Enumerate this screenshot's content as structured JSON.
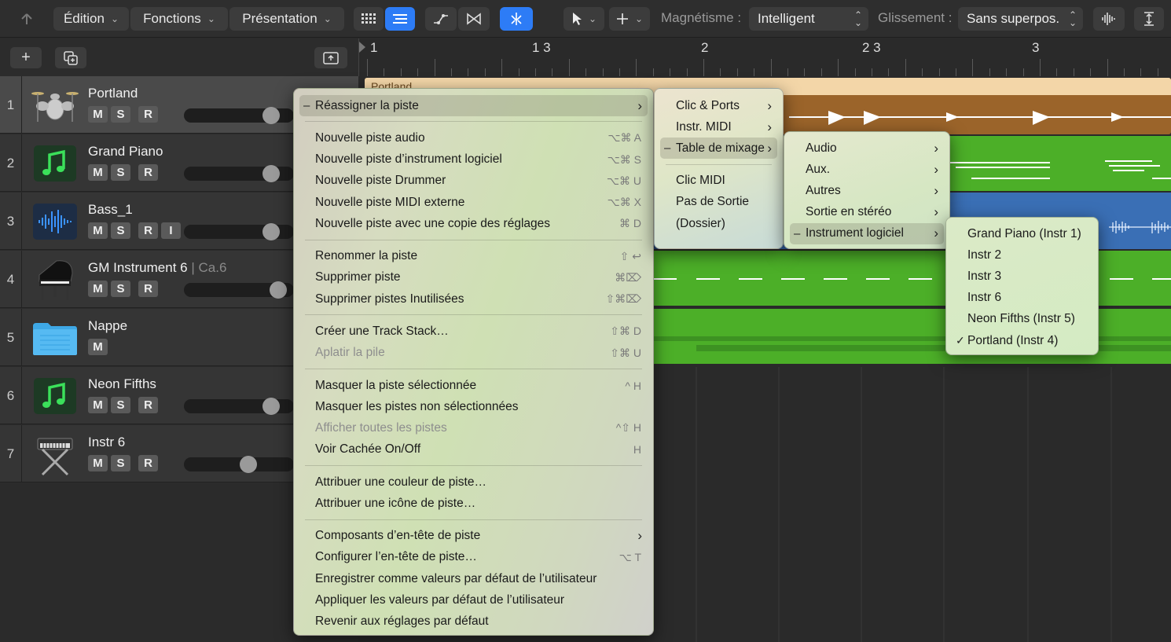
{
  "toolbar": {
    "menus": [
      "Édition",
      "Fonctions",
      "Présentation"
    ],
    "snap_label": "Magnétisme :",
    "snap_value": "Intelligent",
    "drag_label": "Glissement :",
    "drag_value": "Sans superpos."
  },
  "ruler": {
    "labels": [
      "1",
      "1 3",
      "2",
      "2 3",
      "3"
    ]
  },
  "tracks": [
    {
      "num": "1",
      "name": "Portland",
      "sub": "",
      "icon": "drum-kit-icon",
      "buttons": [
        "M",
        "S",
        "R"
      ],
      "volume": 0.85
    },
    {
      "num": "2",
      "name": "Grand Piano",
      "sub": "",
      "icon": "music-note-icon",
      "buttons": [
        "M",
        "S",
        "R"
      ],
      "volume": 0.85
    },
    {
      "num": "3",
      "name": "Bass_1",
      "sub": "",
      "icon": "audio-waveform-icon",
      "buttons": [
        "M",
        "S",
        "R",
        "I"
      ],
      "volume": 0.85
    },
    {
      "num": "4",
      "name": "GM Instrument 6",
      "sub": "| Ca.6",
      "icon": "grand-piano-icon",
      "buttons": [
        "M",
        "S",
        "R"
      ],
      "volume": 0.92
    },
    {
      "num": "5",
      "name": "Nappe",
      "sub": "",
      "icon": "folder-icon",
      "buttons": [
        "M"
      ],
      "volume": null
    },
    {
      "num": "6",
      "name": "Neon Fifths",
      "sub": "",
      "icon": "music-note-icon",
      "buttons": [
        "M",
        "S",
        "R"
      ],
      "volume": 0.85
    },
    {
      "num": "7",
      "name": "Instr 6",
      "sub": "",
      "icon": "keyboard-stand-icon",
      "buttons": [
        "M",
        "S",
        "R"
      ],
      "volume": 0.6
    }
  ],
  "regions": {
    "portland_label": "Portland"
  },
  "colors": {
    "accent": "#2d7cf6",
    "green_region": "#4caf28",
    "brown_region": "#9b642a",
    "blue_region": "#3a6fb5",
    "portland_header": "#f3d6a8"
  },
  "menu_main": [
    {
      "label": "Réassigner la piste",
      "shortcut": "",
      "submenu": true,
      "highlighted": true,
      "disabled": false
    },
    {
      "sep": true
    },
    {
      "label": "Nouvelle piste audio",
      "shortcut": "⌥⌘ A"
    },
    {
      "label": "Nouvelle piste d’instrument logiciel",
      "shortcut": "⌥⌘ S"
    },
    {
      "label": "Nouvelle piste Drummer",
      "shortcut": "⌥⌘ U"
    },
    {
      "label": "Nouvelle piste MIDI externe",
      "shortcut": "⌥⌘ X"
    },
    {
      "label": "Nouvelle piste avec une copie des réglages",
      "shortcut": "⌘ D"
    },
    {
      "sep": true
    },
    {
      "label": "Renommer la piste",
      "shortcut": "⇧ ↩"
    },
    {
      "label": "Supprimer piste",
      "shortcut": "⌘⌦"
    },
    {
      "label": "Supprimer pistes Inutilisées",
      "shortcut": "⇧⌘⌦"
    },
    {
      "sep": true
    },
    {
      "label": "Créer une Track Stack…",
      "shortcut": "⇧⌘ D"
    },
    {
      "label": "Aplatir la pile",
      "shortcut": "⇧⌘ U",
      "disabled": true
    },
    {
      "sep": true
    },
    {
      "label": "Masquer la piste sélectionnée",
      "shortcut": "^ H"
    },
    {
      "label": "Masquer les pistes non sélectionnées",
      "shortcut": ""
    },
    {
      "label": "Afficher toutes les pistes",
      "shortcut": "^⇧ H",
      "disabled": true
    },
    {
      "label": "Voir Cachée On/Off",
      "shortcut": "H"
    },
    {
      "sep": true
    },
    {
      "label": "Attribuer une couleur de piste…",
      "shortcut": ""
    },
    {
      "label": "Attribuer une icône de piste…",
      "shortcut": ""
    },
    {
      "sep": true
    },
    {
      "label": "Composants d’en-tête de piste",
      "shortcut": "",
      "submenu": true
    },
    {
      "label": "Configurer l’en-tête de piste…",
      "shortcut": "⌥ T"
    },
    {
      "label": "Enregistrer comme valeurs par défaut de l’utilisateur",
      "shortcut": ""
    },
    {
      "label": "Appliquer les valeurs par défaut de l’utilisateur",
      "shortcut": ""
    },
    {
      "label": "Revenir aux réglages par défaut",
      "shortcut": ""
    }
  ],
  "menu_reassign": [
    {
      "label": "Clic & Ports",
      "submenu": true
    },
    {
      "label": "Instr. MIDI",
      "submenu": true
    },
    {
      "label": "Table de mixage",
      "submenu": true,
      "highlighted": true
    },
    {
      "sep": true
    },
    {
      "label": "Clic MIDI"
    },
    {
      "label": "Pas de Sortie"
    },
    {
      "label": "(Dossier)"
    }
  ],
  "menu_mixer": [
    {
      "label": "Audio",
      "submenu": true
    },
    {
      "label": "Aux.",
      "submenu": true
    },
    {
      "label": "Autres",
      "submenu": true
    },
    {
      "label": "Sortie en stéréo",
      "submenu": true
    },
    {
      "label": "Instrument logiciel",
      "submenu": true,
      "highlighted": true
    }
  ],
  "menu_instruments": [
    {
      "label": "Grand Piano (Instr 1)"
    },
    {
      "label": "Instr 2"
    },
    {
      "label": "Instr 3"
    },
    {
      "label": "Instr 6"
    },
    {
      "label": "Neon Fifths (Instr 5)"
    },
    {
      "label": "Portland (Instr 4)",
      "checked": true
    }
  ]
}
